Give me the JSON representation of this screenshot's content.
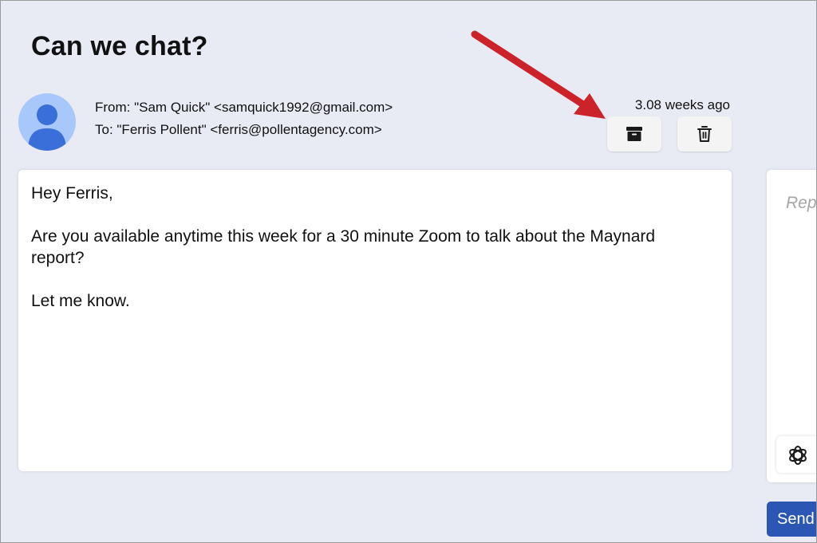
{
  "email": {
    "subject": "Can we chat?",
    "from": "From: \"Sam Quick\" <samquick1992@gmail.com>",
    "to": "To: \"Ferris Pollent\" <ferris@pollentagency.com>",
    "timestamp": "3.08 weeks ago",
    "body": {
      "greeting": "Hey Ferris,",
      "paragraph": "Are you available anytime this week for a 30 minute Zoom to talk about the Maynard report?",
      "closing": "Let me know."
    }
  },
  "actions": {
    "archive_icon": "archive-icon",
    "delete_icon": "trash-icon"
  },
  "reply": {
    "placeholder": "Rep",
    "ai_icon": "openai-icon",
    "send_label": "Send"
  },
  "annotation": {
    "arrow_color": "#cc2229"
  },
  "colors": {
    "background": "#e8ebf4",
    "send_button": "#2c56b4",
    "avatar_bg": "#a8c7fa",
    "avatar_fg": "#3a6fd9"
  }
}
